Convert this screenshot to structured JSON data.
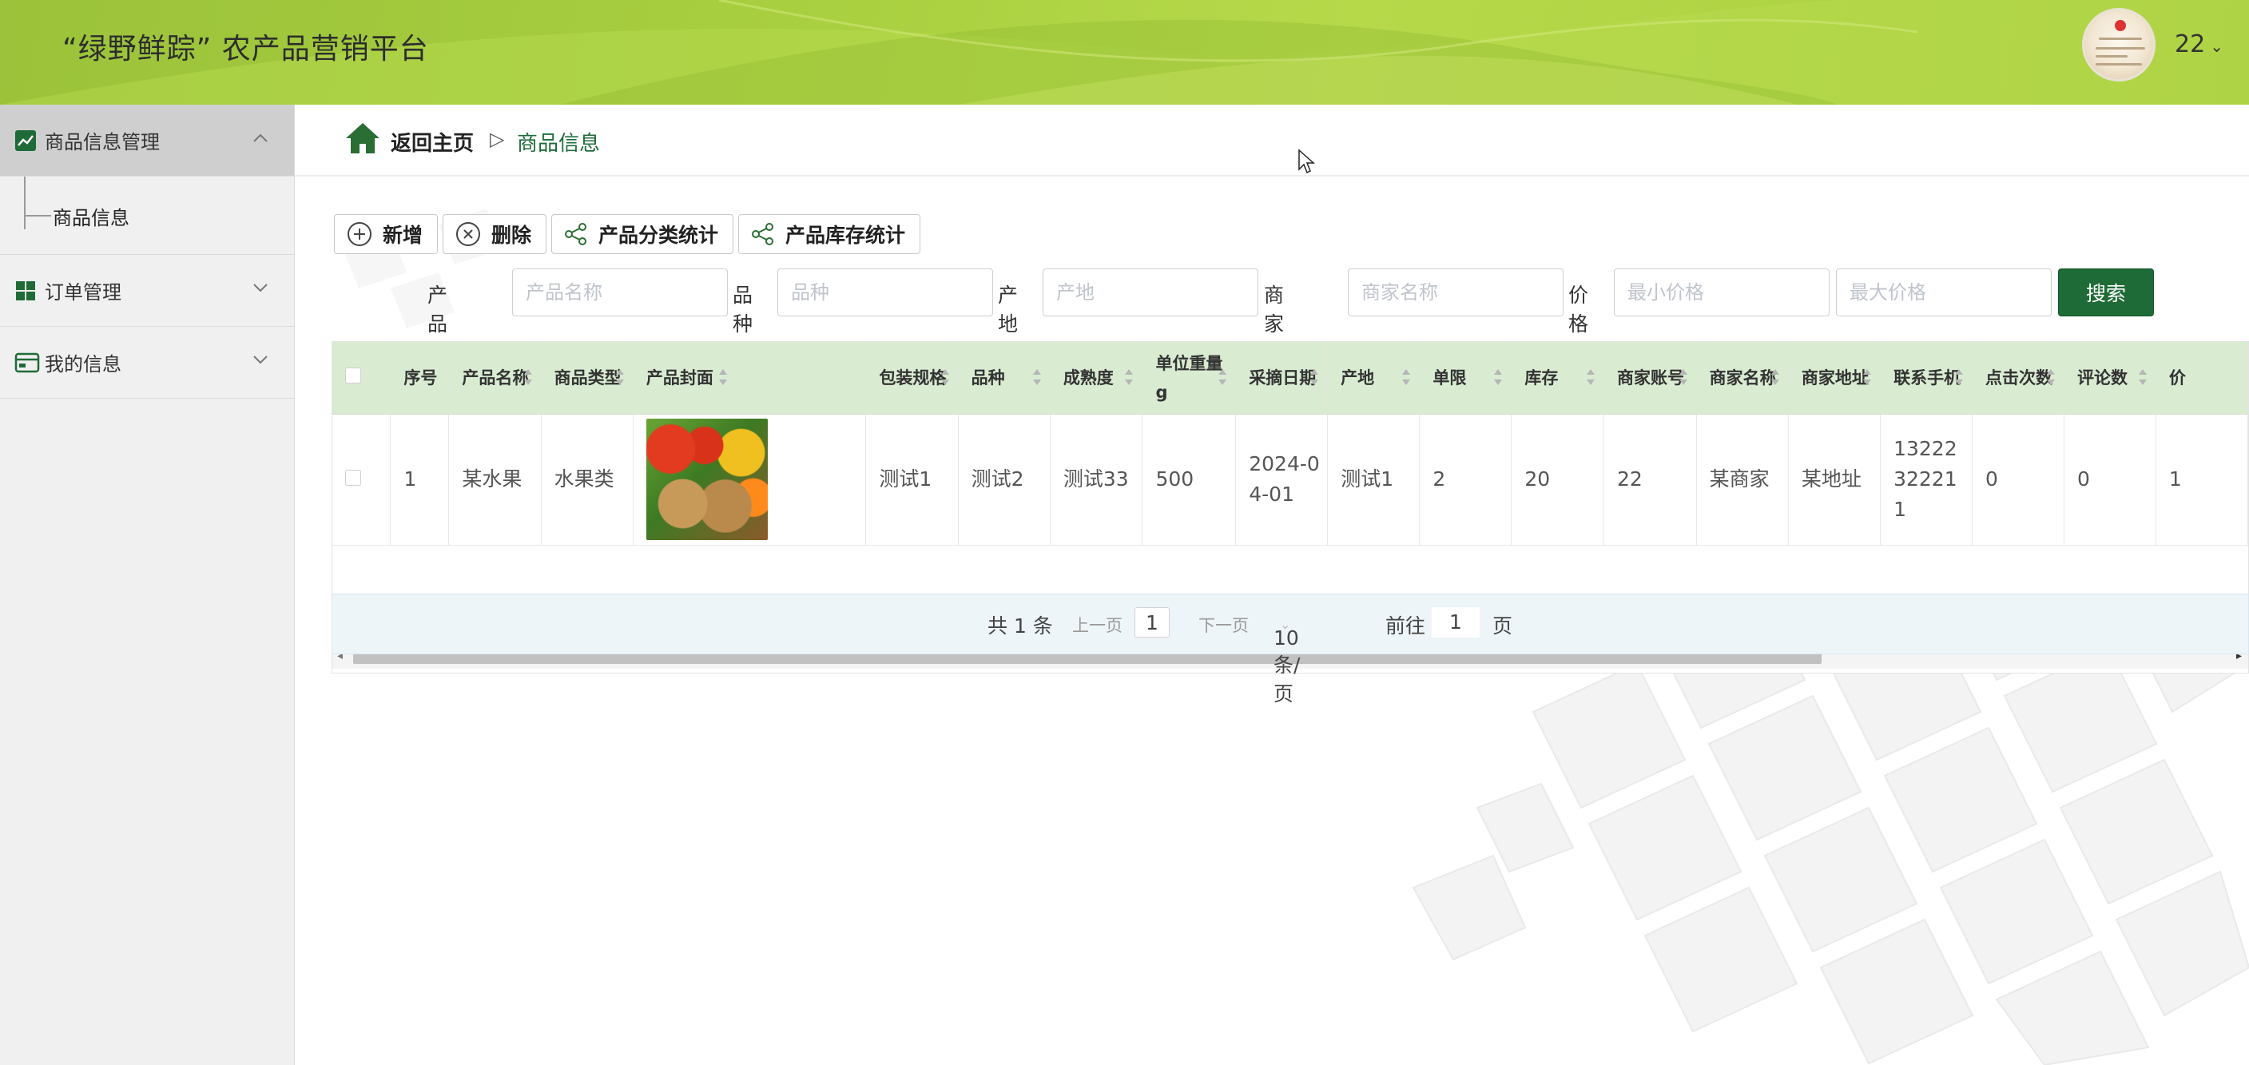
{
  "header": {
    "title": "“绿野鲜踪”  农产品营销平台",
    "user": "22",
    "user_chevron": "⌄"
  },
  "sidebar": {
    "groups": [
      {
        "label": "商品信息管理",
        "icon": "chart-line-icon",
        "expanded": true,
        "items": [
          {
            "label": "商品信息"
          }
        ]
      },
      {
        "label": "订单管理",
        "icon": "grid-icon",
        "expanded": false
      },
      {
        "label": "我的信息",
        "icon": "card-icon",
        "expanded": false
      }
    ]
  },
  "breadcrumb": {
    "home": "返回主页",
    "separator": "▷",
    "current": "商品信息"
  },
  "toolbar": {
    "add": "新增",
    "delete": "删除",
    "category_stats": "产品分类统计",
    "stock_stats": "产品库存统计"
  },
  "search": {
    "name_label": "产品名称",
    "name_placeholder": "产品名称",
    "variety_label": "品种",
    "variety_placeholder": "品种",
    "origin_label": "产地",
    "origin_placeholder": "产地",
    "merchant_label": "商家名称",
    "merchant_placeholder": "商家名称",
    "price_label": "价格",
    "min_placeholder": "最小价格",
    "max_placeholder": "最大价格",
    "button": "搜索"
  },
  "table": {
    "columns": [
      "序号",
      "产品名称",
      "商品类型",
      "产品封面",
      "包装规格",
      "品种",
      "成熟度",
      "单位重量g",
      "采摘日期",
      "产地",
      "单限",
      "库存",
      "商家账号",
      "商家名称",
      "商家地址",
      "联系手机",
      "点击次数",
      "评论数",
      "价"
    ],
    "rows": [
      [
        "1",
        "某水果",
        "水果类",
        "",
        "测试1",
        "测试2",
        "测试33",
        "500",
        "2024-04-01",
        "测试1",
        "2",
        "20",
        "22",
        "某商家",
        "某地址",
        "13222322211",
        "0",
        "0",
        "1"
      ]
    ]
  },
  "pagination": {
    "total": "共 1 条",
    "prev": "上一页",
    "page": "1",
    "next": "下一页",
    "size": "10条/页",
    "goto": "前往",
    "goto_value": "1",
    "page_unit": "页"
  },
  "colors": {
    "accent": "#1f6b37",
    "header_green": "#a8cf3f",
    "table_header": "#d9ecd2"
  }
}
